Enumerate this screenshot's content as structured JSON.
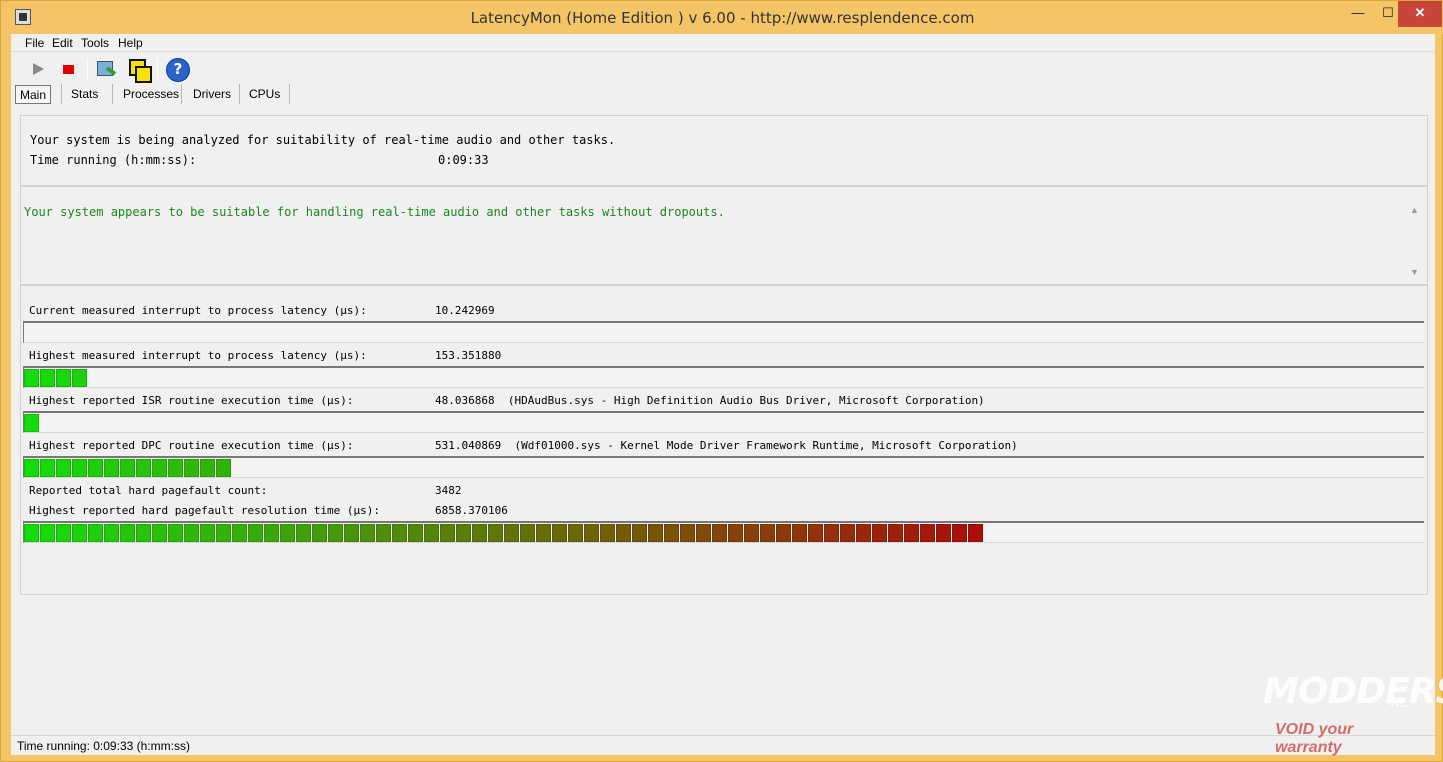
{
  "window": {
    "title": "LatencyMon  (Home Edition )  v 6.00 - http://www.resplendence.com",
    "close_symbol": "✕",
    "minimize_symbol": "—",
    "maximize_symbol": "☐"
  },
  "menu": [
    {
      "label": "File"
    },
    {
      "label": "Edit"
    },
    {
      "label": "Tools"
    },
    {
      "label": "Help"
    }
  ],
  "toolbar": {
    "icons": [
      "play-icon",
      "stop-icon",
      "tool-monitor-icon",
      "tool-windows-icon",
      "help-icon"
    ]
  },
  "tabs": [
    {
      "label": "Main",
      "active": true
    },
    {
      "label": "Stats",
      "active": false
    },
    {
      "label": "Processes",
      "active": false
    },
    {
      "label": "Drivers",
      "active": false
    },
    {
      "label": "CPUs",
      "active": false
    }
  ],
  "analysis": {
    "status": "Your system is being analyzed for suitability of real-time audio and other tasks.",
    "time_label": "Time running (h:mm:ss):",
    "time_value": "0:09:33"
  },
  "verdict": {
    "text": "Your system appears to be suitable for handling real-time audio and other tasks without dropouts.",
    "color": "#1a8a1a"
  },
  "metrics": [
    {
      "label": "Current measured interrupt to process latency (µs):",
      "value": "10.242969",
      "detail": "",
      "bar_fraction": 0.0
    },
    {
      "label": "Highest measured interrupt to process latency (µs):",
      "value": "153.351880",
      "detail": "",
      "bar_fraction": 0.045
    },
    {
      "label": "Highest reported ISR routine execution time (µs):",
      "value": "48.036868",
      "detail": "(HDAudBus.sys - High Definition Audio Bus Driver, Microsoft Corporation)",
      "bar_fraction": 0.01
    },
    {
      "label": "Highest reported DPC routine execution time (µs):",
      "value": "531.040869",
      "detail": "(Wdf01000.sys - Kernel Mode Driver Framework Runtime, Microsoft Corporation)",
      "bar_fraction": 0.148
    },
    {
      "label": "Reported total hard pagefault count:",
      "value": "3482",
      "detail": "",
      "bar_fraction": null
    },
    {
      "label": "Highest reported hard pagefault resolution time (µs):",
      "value": "6858.370106",
      "detail": "",
      "bar_fraction": 0.685
    }
  ],
  "statusbar": {
    "text": "Time running: 0:09:33  (h:mm:ss)"
  },
  "watermark": {
    "main": "MODDERS",
    "inc": "INC.",
    "sub": "VOID your warranty"
  }
}
